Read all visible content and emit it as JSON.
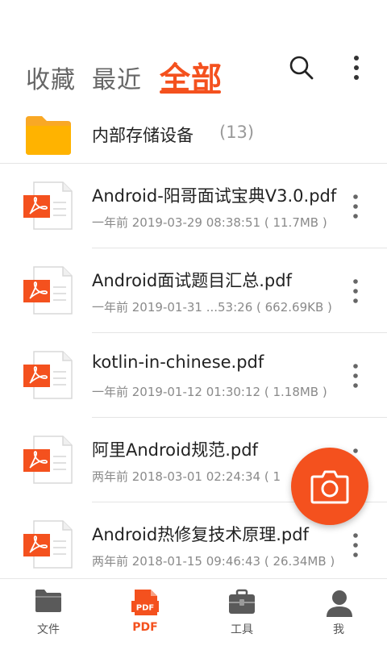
{
  "tabs": [
    {
      "label": "收藏"
    },
    {
      "label": "最近"
    },
    {
      "label": "全部"
    }
  ],
  "storage": {
    "label": "内部存储设备",
    "count": "(13)"
  },
  "files": [
    {
      "name": "Android-阳哥面试宝典V3.0.pdf",
      "meta": "一年前 2019-03-29 08:38:51 ( 11.7MB )"
    },
    {
      "name": "Android面试题目汇总.pdf",
      "meta": "一年前 2019-01-31 ...53:26 ( 662.69KB )"
    },
    {
      "name": "kotlin-in-chinese.pdf",
      "meta": "一年前 2019-01-12 01:30:12 ( 1.18MB )"
    },
    {
      "name": "阿里Android规范.pdf",
      "meta": "两年前 2018-03-01 02:24:34 ( 1"
    },
    {
      "name": "Android热修复技术原理.pdf",
      "meta": "两年前 2018-01-15 09:46:43 ( 26.34MB )"
    }
  ],
  "bottom_nav": [
    {
      "label": "文件",
      "icon": "folder-icon"
    },
    {
      "label": "PDF",
      "icon": "pdf-icon",
      "icon_text": "PDF"
    },
    {
      "label": "工具",
      "icon": "toolbox-icon"
    },
    {
      "label": "我",
      "icon": "person-icon"
    }
  ],
  "colors": {
    "accent": "#f4511e",
    "folder": "#ffb300"
  }
}
